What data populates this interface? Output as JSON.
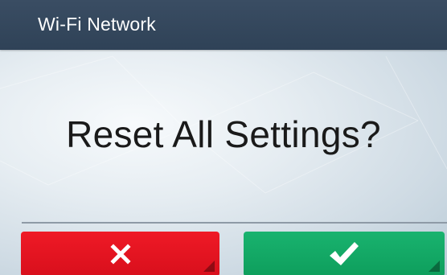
{
  "header": {
    "title": "Wi-Fi Network",
    "background_color": "#33465c"
  },
  "dialog": {
    "prompt": "Reset All Settings?"
  },
  "actions": {
    "cancel": {
      "icon": "close-icon",
      "color": "#e5141f"
    },
    "confirm": {
      "icon": "checkmark-icon",
      "color": "#15a866"
    }
  }
}
